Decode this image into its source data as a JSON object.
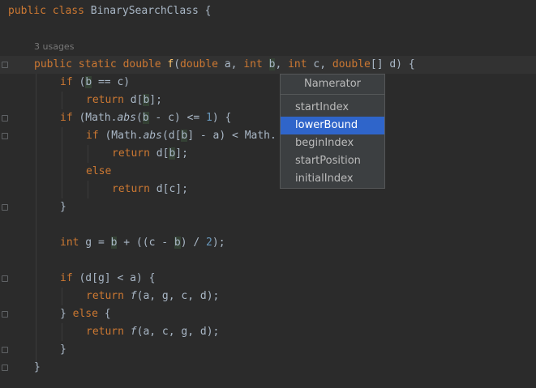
{
  "code": {
    "class_kw": "public class ",
    "class_name": "BinarySearchClass {",
    "usages": "3 usages",
    "sig_public": "public static double ",
    "sig_fn": "f",
    "sig_params_a": "(",
    "sig_double": "double",
    "sig_a": " a, ",
    "sig_int1": "int",
    "sig_sp": " ",
    "sig_b": "b",
    "sig_comma": ", ",
    "sig_int2": "int",
    "sig_c": " c, ",
    "sig_double2": "double",
    "sig_rest": "[] d) {",
    "l3_if": "if",
    "l3_a": " (",
    "l3_b": "b",
    "l3_rest": " == c)",
    "l4_return": "return",
    "l4_a": " d[",
    "l4_b": "b",
    "l4_rest": "];",
    "l5_if": "if",
    "l5_a": " (Math.",
    "l5_abs": "abs",
    "l5_b1": "(",
    "l5_b": "b",
    "l5_c": " - c) <= ",
    "l5_num": "1",
    "l5_rest": ") {",
    "l6_if": "if",
    "l6_a": " (Math.",
    "l6_abs": "abs",
    "l6_b1": "(d[",
    "l6_b": "b",
    "l6_rest": "] - a) < Math.",
    "l7_return": "return",
    "l7_a": " d[",
    "l7_b": "b",
    "l7_rest": "];",
    "l8_else": "else",
    "l9_return": "return",
    "l9_rest": " d[c];",
    "l10": "}",
    "l12_int": "int",
    "l12_a": " g = ",
    "l12_b": "b",
    "l12_c": " + ((c - ",
    "l12_b2": "b",
    "l12_d": ") / ",
    "l12_num": "2",
    "l12_rest": ");",
    "l14_if": "if",
    "l14_rest": " (d[g] < a) {",
    "l15_return": "return",
    "l15_f": " f",
    "l15_rest": "(a, g, c, d);",
    "l16_a": "} ",
    "l16_else": "else",
    "l16_rest": " {",
    "l17_return": "return",
    "l17_f": " f",
    "l17_rest": "(a, c, g, d);",
    "l18": "}",
    "l19": "}"
  },
  "popup": {
    "title": "Namerator",
    "items": [
      "startIndex",
      "lowerBound",
      "beginIndex",
      "startPosition",
      "initialIndex"
    ],
    "selected": "lowerBound"
  }
}
